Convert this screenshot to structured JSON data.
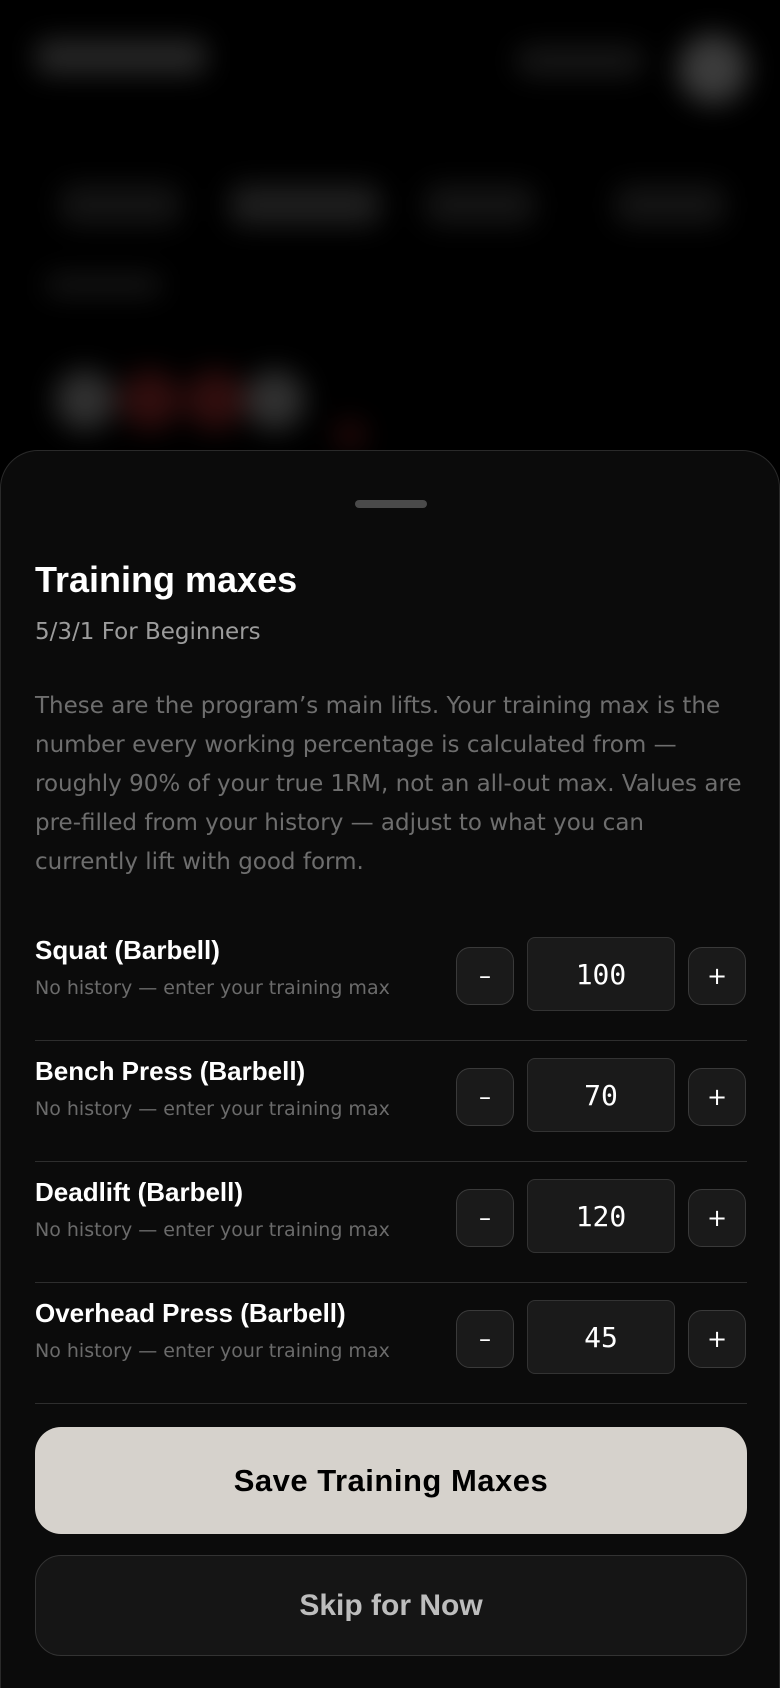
{
  "sheet": {
    "title": "Training maxes",
    "subtitle": "5/3/1 For Beginners",
    "description": "These are the program’s main lifts. Your training max is the number every working percentage is calculated from — roughly 90% of your true 1RM, not an all-out max. Values are pre-filled from your history — adjust to what you can currently lift with good form."
  },
  "lifts": [
    {
      "name": "Squat (Barbell)",
      "hint": "No history — enter your training max",
      "value": "100",
      "minus_label": "–",
      "plus_label": "+"
    },
    {
      "name": "Bench Press (Barbell)",
      "hint": "No history — enter your training max",
      "value": "70",
      "minus_label": "–",
      "plus_label": "+"
    },
    {
      "name": "Deadlift (Barbell)",
      "hint": "No history — enter your training max",
      "value": "120",
      "minus_label": "–",
      "plus_label": "+"
    },
    {
      "name": "Overhead Press (Barbell)",
      "hint": "No history — enter your training max",
      "value": "45",
      "minus_label": "–",
      "plus_label": "+"
    }
  ],
  "actions": {
    "save_label": "Save Training Maxes",
    "skip_label": "Skip for Now"
  },
  "colors": {
    "sheet_background": "#0b0b0b",
    "primary_button": "#d6d2cc",
    "secondary_button": "#151515"
  }
}
